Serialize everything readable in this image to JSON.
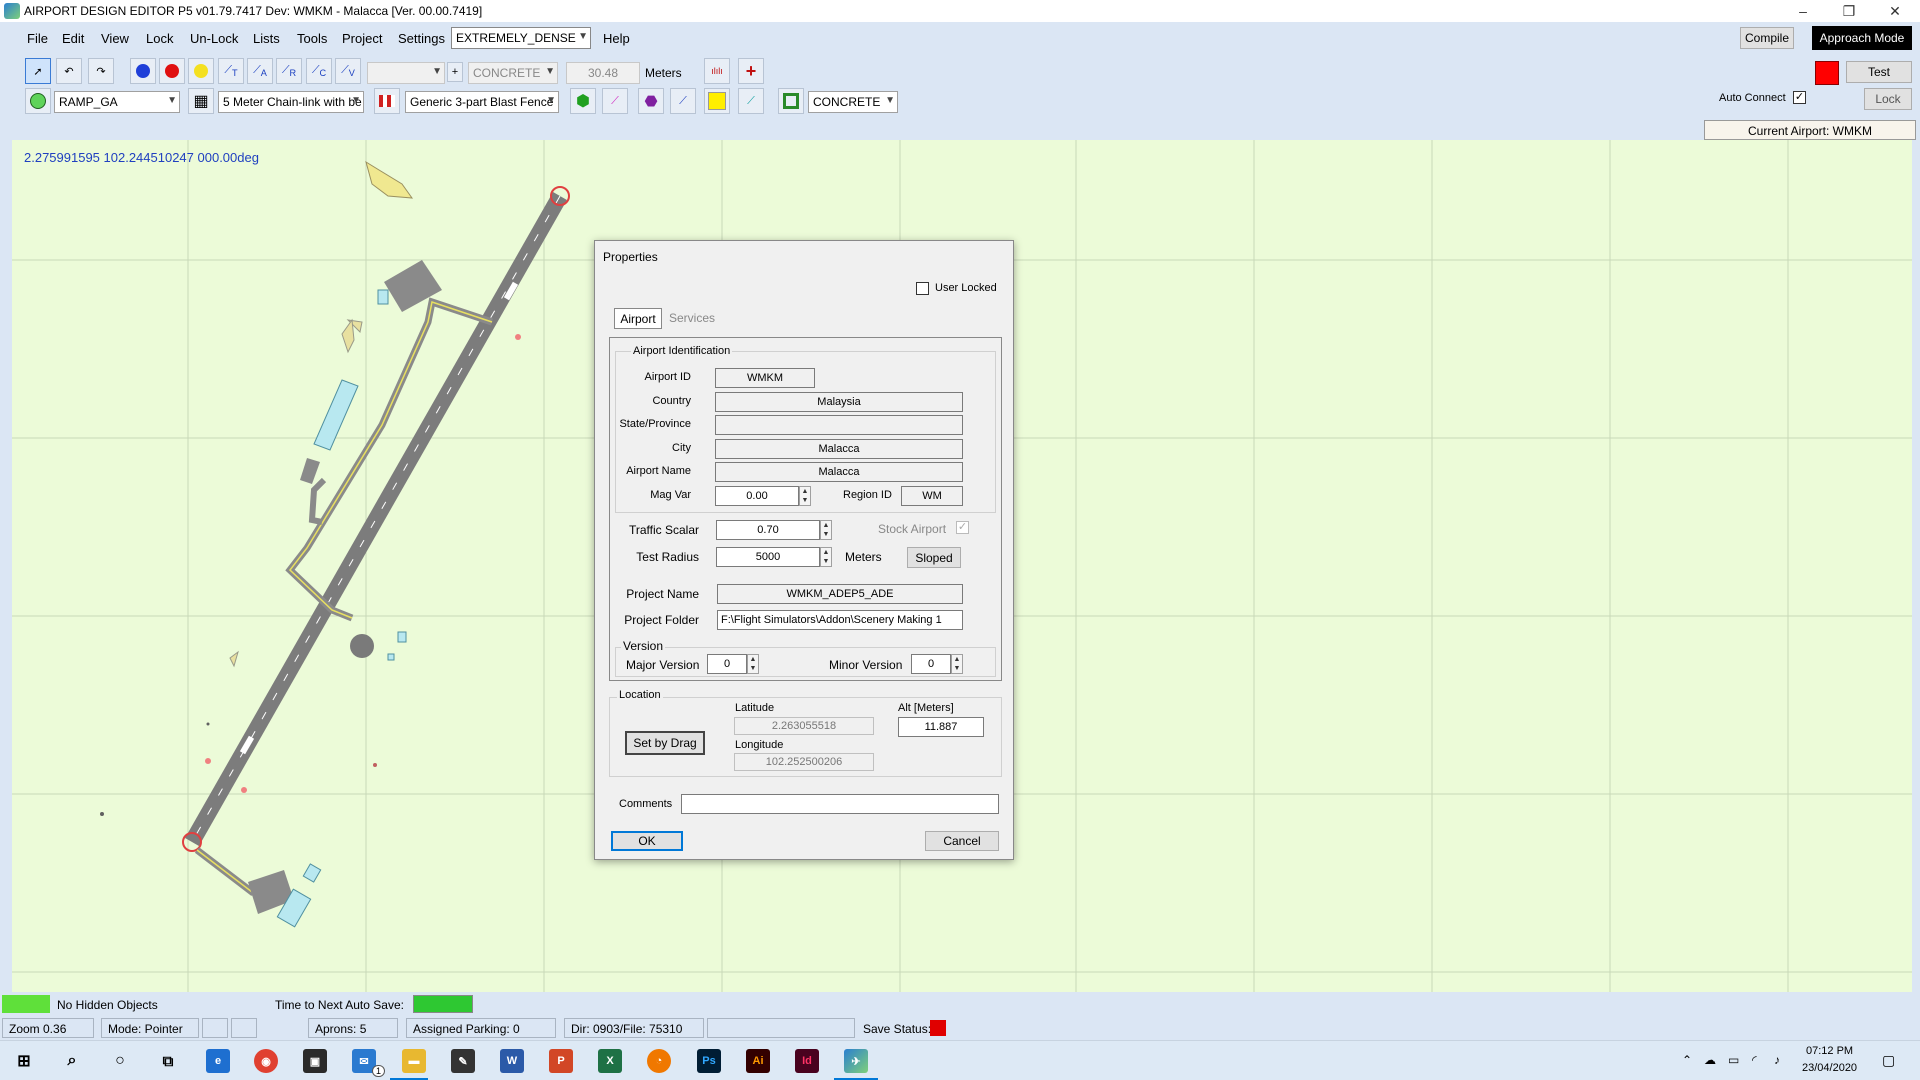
{
  "window": {
    "title": "AIRPORT DESIGN EDITOR P5  v01.79.7417 Dev: WMKM - Malacca [Ver. 00.00.7419]",
    "minimize": "–",
    "maximize": "❐",
    "close": "✕"
  },
  "menu": [
    "File",
    "Edit",
    "View",
    "Lock",
    "Un-Lock",
    "Lists",
    "Tools",
    "Project",
    "Settings",
    "Help"
  ],
  "density_select": "EXTREMELY_DENSE",
  "topright": {
    "compile": "Compile",
    "approach_mode": "Approach Mode",
    "test": "Test",
    "auto_connect": "Auto Connect",
    "lock": "Lock",
    "current_airport": "Current Airport: WMKM"
  },
  "toolbar1": {
    "tool_letters": [
      "T",
      "A",
      "R",
      "C",
      "V"
    ],
    "plus": "+",
    "surface": "CONCRETE",
    "width_value": "30.48",
    "units": "Meters"
  },
  "toolbar2": {
    "ramp": "RAMP_GA",
    "fence": "5 Meter Chain-link with be",
    "blast_fence": "Generic 3-part Blast Fence",
    "surface": "CONCRETE"
  },
  "map": {
    "coords": "2.275991595    102.244510247 000.00deg"
  },
  "dialog": {
    "title": "Properties",
    "user_locked": "User Locked",
    "tabs": [
      "Airport",
      "Services"
    ],
    "group_ident": "Airport Identification",
    "airport_id_label": "Airport ID",
    "airport_id": "WMKM",
    "country_label": "Country",
    "country": "Malaysia",
    "state_label": "State/Province",
    "state": "",
    "city_label": "City",
    "city": "Malacca",
    "airport_name_label": "Airport Name",
    "airport_name": "Malacca",
    "magvar_label": "Mag Var",
    "magvar": "0.00",
    "region_label": "Region ID",
    "region": "WM",
    "traffic_label": "Traffic Scalar",
    "traffic": "0.70",
    "stock_label": "Stock Airport",
    "radius_label": "Test Radius",
    "radius": "5000",
    "radius_units": "Meters",
    "sloped": "Sloped",
    "project_name_label": "Project Name",
    "project_name": "WMKM_ADEP5_ADE",
    "project_folder_label": "Project Folder",
    "project_folder": "F:\\Flight Simulators\\Addon\\Scenery Making 1",
    "version_label": "Version",
    "major_label": "Major Version",
    "major": "0",
    "minor_label": "Minor Version",
    "minor": "0",
    "location_label": "Location",
    "latitude_label": "Latitude",
    "latitude": "2.263055518",
    "alt_label": "Alt [Meters]",
    "alt": "11.887",
    "set_by_drag": "Set by Drag",
    "longitude_label": "Longitude",
    "longitude": "102.252500206",
    "comments_label": "Comments",
    "comments": "",
    "ok": "OK",
    "cancel": "Cancel"
  },
  "status": {
    "hidden": "No Hidden Objects",
    "autosave": "Time to Next Auto Save:",
    "zoom": "Zoom 0.36",
    "mode": "Mode: Pointer",
    "aprons": "Aprons: 5",
    "parking": "Assigned Parking: 0",
    "dir": "Dir: 0903/File: 75310",
    "save": "Save Status:"
  },
  "taskbar": {
    "time": "07:12 PM",
    "date": "23/04/2020",
    "mail_badge": "1"
  },
  "colors": {
    "map_bg": "#ecfbd8",
    "grid": "#c8d8b8",
    "runway": "#7c7c7c",
    "taxiway_line": "#e8e060",
    "accent": "#0078d7",
    "status_green": "#2ec832",
    "status_red": "#e00000"
  }
}
